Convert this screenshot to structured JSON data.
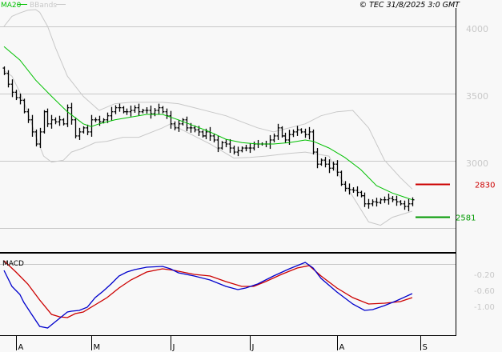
{
  "chart_data": {
    "type": "line",
    "title": "",
    "copyright": "© TEC 31/8/2025 3:0 GMT",
    "legend": [
      {
        "name": "MA20",
        "color": "#00c000"
      },
      {
        "name": "BBands",
        "color": "#c8c8c8"
      }
    ],
    "price_axis": {
      "ylim": [
        2400,
        4200
      ],
      "ticks": [
        4000,
        3500,
        3000
      ],
      "tick_labels": [
        "4000",
        "3500",
        "3000"
      ],
      "gridlines": [
        4000,
        3500,
        3000,
        2500
      ]
    },
    "x_months": [
      "A",
      "M",
      "J",
      "J",
      "A",
      "S"
    ],
    "x_month_day_index": [
      3,
      22,
      42,
      62,
      84,
      105
    ],
    "closes": [
      3650,
      3570,
      3510,
      3470,
      3450,
      3365,
      3305,
      3215,
      3125,
      3215,
      3365,
      3275,
      3305,
      3290,
      3305,
      3275,
      3395,
      3305,
      3185,
      3215,
      3245,
      3215,
      3305,
      3305,
      3290,
      3305,
      3335,
      3365,
      3395,
      3395,
      3365,
      3365,
      3375,
      3395,
      3365,
      3375,
      3375,
      3350,
      3375,
      3395,
      3365,
      3335,
      3275,
      3245,
      3275,
      3305,
      3245,
      3245,
      3230,
      3215,
      3185,
      3215,
      3185,
      3155,
      3095,
      3135,
      3125,
      3095,
      3065,
      3075,
      3095,
      3095,
      3095,
      3125,
      3125,
      3125,
      3125,
      3155,
      3185,
      3245,
      3185,
      3155,
      3195,
      3215,
      3230,
      3215,
      3195,
      3215,
      3065,
      2975,
      3005,
      2975,
      2945,
      2975,
      2915,
      2825,
      2795,
      2785,
      2780,
      2765,
      2740,
      2680,
      2680,
      2695,
      2690,
      2710,
      2710,
      2720,
      2710,
      2695,
      2680,
      2660,
      2680,
      2710
    ],
    "ma20": [
      [
        0,
        3850
      ],
      [
        4,
        3750
      ],
      [
        8,
        3600
      ],
      [
        12,
        3480
      ],
      [
        16,
        3365
      ],
      [
        20,
        3275
      ],
      [
        22,
        3255
      ],
      [
        24,
        3275
      ],
      [
        28,
        3305
      ],
      [
        32,
        3325
      ],
      [
        36,
        3345
      ],
      [
        40,
        3345
      ],
      [
        44,
        3305
      ],
      [
        48,
        3260
      ],
      [
        52,
        3215
      ],
      [
        56,
        3160
      ],
      [
        60,
        3135
      ],
      [
        64,
        3125
      ],
      [
        68,
        3125
      ],
      [
        72,
        3135
      ],
      [
        76,
        3155
      ],
      [
        78,
        3145
      ],
      [
        82,
        3095
      ],
      [
        86,
        3025
      ],
      [
        90,
        2935
      ],
      [
        94,
        2815
      ],
      [
        98,
        2760
      ],
      [
        103,
        2710
      ]
    ],
    "bband_upper": [
      [
        0,
        4000
      ],
      [
        2,
        4075
      ],
      [
        4,
        4100
      ],
      [
        6,
        4120
      ],
      [
        8,
        4125
      ],
      [
        9,
        4105
      ],
      [
        11,
        4000
      ],
      [
        13,
        3840
      ],
      [
        16,
        3630
      ],
      [
        20,
        3480
      ],
      [
        24,
        3375
      ],
      [
        28,
        3425
      ],
      [
        32,
        3435
      ],
      [
        36,
        3435
      ],
      [
        40,
        3435
      ],
      [
        44,
        3425
      ],
      [
        48,
        3395
      ],
      [
        52,
        3365
      ],
      [
        56,
        3335
      ],
      [
        60,
        3290
      ],
      [
        64,
        3245
      ],
      [
        68,
        3215
      ],
      [
        72,
        3245
      ],
      [
        76,
        3275
      ],
      [
        80,
        3335
      ],
      [
        84,
        3365
      ],
      [
        88,
        3375
      ],
      [
        92,
        3245
      ],
      [
        96,
        3005
      ],
      [
        100,
        2875
      ],
      [
        103,
        2790
      ]
    ],
    "bband_lower": [
      [
        0,
        3670
      ],
      [
        2,
        3630
      ],
      [
        4,
        3510
      ],
      [
        6,
        3365
      ],
      [
        8,
        3185
      ],
      [
        10,
        3035
      ],
      [
        12,
        2990
      ],
      [
        15,
        3005
      ],
      [
        17,
        3065
      ],
      [
        20,
        3095
      ],
      [
        23,
        3135
      ],
      [
        26,
        3145
      ],
      [
        30,
        3175
      ],
      [
        34,
        3175
      ],
      [
        40,
        3245
      ],
      [
        42,
        3275
      ],
      [
        46,
        3215
      ],
      [
        52,
        3125
      ],
      [
        58,
        3020
      ],
      [
        62,
        3025
      ],
      [
        66,
        3035
      ],
      [
        72,
        3055
      ],
      [
        76,
        3065
      ],
      [
        78,
        3055
      ],
      [
        82,
        3035
      ],
      [
        84,
        2915
      ],
      [
        88,
        2735
      ],
      [
        92,
        2545
      ],
      [
        95,
        2520
      ],
      [
        98,
        2580
      ],
      [
        103,
        2625
      ]
    ],
    "levels": [
      {
        "label": "2830",
        "value": 2830,
        "color": "#cc0000"
      },
      {
        "label": "2581",
        "value": 2581,
        "color": "#009900"
      }
    ],
    "macd": {
      "label": "MACD",
      "ticks": [
        "-0.20",
        "-0.60",
        "-1.00"
      ],
      "tick_values": [
        -0.2,
        -0.6,
        -1.0
      ],
      "macd_color": "#0000cc",
      "signal_color": "#cc0000",
      "macd_line": [
        [
          0,
          -0.1
        ],
        [
          2,
          -0.5
        ],
        [
          4,
          -0.7
        ],
        [
          5,
          -0.9
        ],
        [
          7,
          -1.2
        ],
        [
          9,
          -1.5
        ],
        [
          11,
          -1.54
        ],
        [
          12,
          -1.46
        ],
        [
          14,
          -1.3
        ],
        [
          16,
          -1.14
        ],
        [
          17,
          -1.12
        ],
        [
          19,
          -1.1
        ],
        [
          21,
          -1.02
        ],
        [
          23,
          -0.78
        ],
        [
          25,
          -0.62
        ],
        [
          27,
          -0.44
        ],
        [
          29,
          -0.24
        ],
        [
          31,
          -0.14
        ],
        [
          33,
          -0.08
        ],
        [
          36,
          -0.02
        ],
        [
          40,
          0.0
        ],
        [
          42,
          -0.06
        ],
        [
          44,
          -0.16
        ],
        [
          48,
          -0.24
        ],
        [
          52,
          -0.34
        ],
        [
          56,
          -0.5
        ],
        [
          59,
          -0.58
        ],
        [
          61,
          -0.54
        ],
        [
          64,
          -0.44
        ],
        [
          68,
          -0.24
        ],
        [
          72,
          -0.06
        ],
        [
          76,
          0.1
        ],
        [
          78,
          -0.04
        ],
        [
          80,
          -0.3
        ],
        [
          84,
          -0.64
        ],
        [
          88,
          -0.94
        ],
        [
          91,
          -1.1
        ],
        [
          93,
          -1.08
        ],
        [
          96,
          -0.98
        ],
        [
          99,
          -0.86
        ],
        [
          103,
          -0.68
        ]
      ],
      "signal_line": [
        [
          0,
          0.14
        ],
        [
          3,
          -0.14
        ],
        [
          6,
          -0.44
        ],
        [
          9,
          -0.84
        ],
        [
          12,
          -1.2
        ],
        [
          14,
          -1.26
        ],
        [
          16,
          -1.28
        ],
        [
          18,
          -1.18
        ],
        [
          20,
          -1.14
        ],
        [
          23,
          -0.96
        ],
        [
          26,
          -0.78
        ],
        [
          29,
          -0.54
        ],
        [
          32,
          -0.34
        ],
        [
          36,
          -0.14
        ],
        [
          40,
          -0.06
        ],
        [
          43,
          -0.1
        ],
        [
          48,
          -0.2
        ],
        [
          52,
          -0.24
        ],
        [
          56,
          -0.38
        ],
        [
          60,
          -0.5
        ],
        [
          63,
          -0.5
        ],
        [
          66,
          -0.38
        ],
        [
          70,
          -0.2
        ],
        [
          74,
          -0.04
        ],
        [
          77,
          0.02
        ],
        [
          80,
          -0.24
        ],
        [
          84,
          -0.54
        ],
        [
          88,
          -0.78
        ],
        [
          92,
          -0.94
        ],
        [
          96,
          -0.92
        ],
        [
          100,
          -0.88
        ],
        [
          103,
          -0.78
        ]
      ]
    }
  }
}
